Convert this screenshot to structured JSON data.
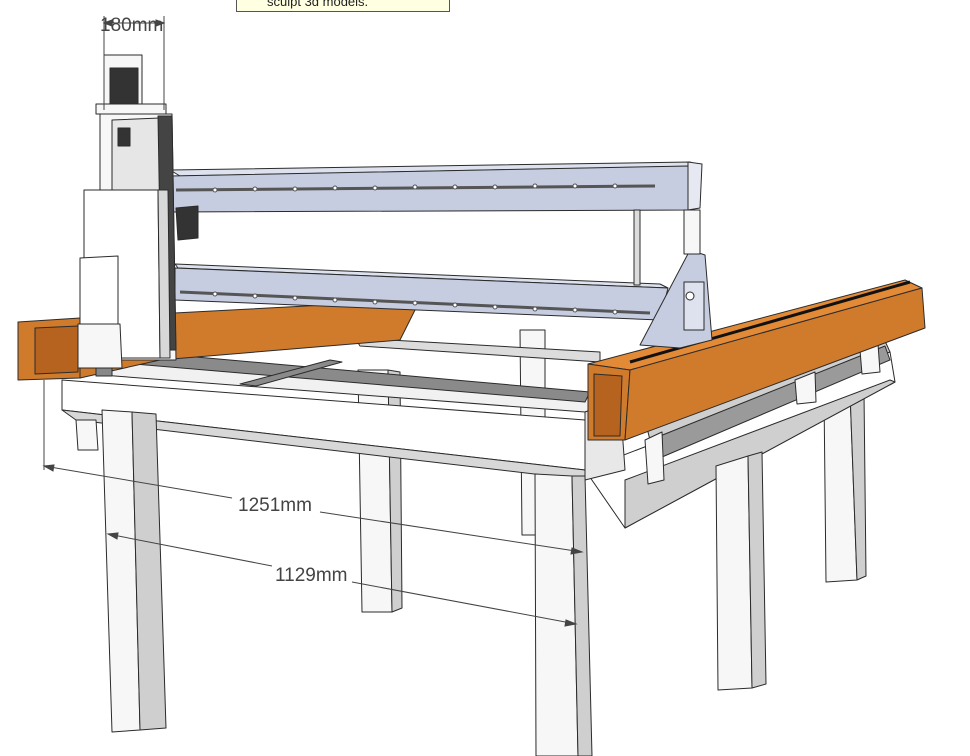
{
  "tooltip": {
    "text": "sculpt 3d models."
  },
  "dimensions": {
    "spindle_width": "180mm",
    "outer_width": "1251mm",
    "inner_width": "1129mm"
  },
  "colors": {
    "rail_orange": "#d07a2b",
    "gantry_blue": "#c6cde0",
    "frame_white": "#f7f7f7",
    "frame_shadow": "#cfcfcf",
    "line": "#2b2b2b"
  }
}
